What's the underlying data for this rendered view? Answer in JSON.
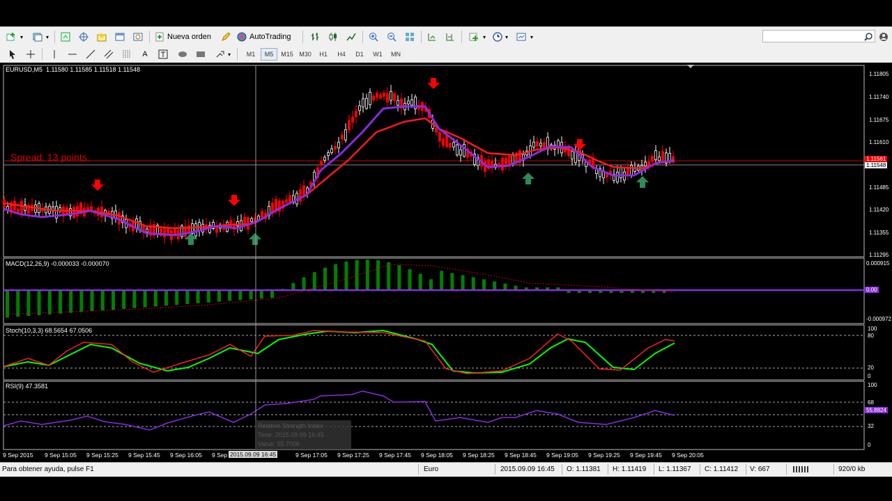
{
  "toolbar": {
    "new_order": "Nueva orden",
    "autotrading": "AutoTrading",
    "timeframes": [
      "M1",
      "M5",
      "M15",
      "M30",
      "H1",
      "H4",
      "D1",
      "W1",
      "MN"
    ],
    "selected_timeframe": "M5"
  },
  "chart": {
    "symbol_header": "EURUSD,M5  1.11580 1.11585 1.11518 1.11548",
    "spread_text": "Spread: 13 points.",
    "price_scale": [
      "1.11805",
      "1.11740",
      "1.11675",
      "1.11610",
      "1.11485",
      "1.11420",
      "1.11355",
      "1.11295"
    ],
    "bid_label": "1.11548",
    "ask_label": "1.11561",
    "macd": {
      "label": "MACD(12,26,9) -0.000033 -0.000070",
      "top": "0.000915",
      "zero": "0.00",
      "bottom": "-0.000972"
    },
    "stoch": {
      "label": "Stoch(10,3,3) 68.5654 67.0506",
      "levels": [
        "100",
        "80",
        "20",
        "0"
      ]
    },
    "rsi": {
      "label": "RSI(9) 47.3581",
      "levels": [
        "100",
        "68",
        "32",
        "0"
      ],
      "value_label": "55.8824"
    },
    "time_labels": [
      "9 Sep 2015",
      "9 Sep 15:05",
      "9 Sep 15:25",
      "9 Sep 15:45",
      "9 Sep 16:05",
      "9 Sep 16:25",
      "9 Sep 16:45",
      "9 Sep 17:05",
      "9 Sep 17:25",
      "9 Sep 17:45",
      "9 Sep 18:05",
      "9 Sep 18:25",
      "9 Sep 18:45",
      "9 Sep 19:05",
      "9 Sep 19:25",
      "9 Sep 19:45",
      "9 Sep 20:05"
    ],
    "crosshair_time": "2015.09.09 16:45",
    "tooltip": {
      "name": "Relative Strength Index",
      "time": "Time: 2015.09.09 16:45",
      "value": "Value: 55.7006"
    }
  },
  "status": {
    "help": "Para obtener ayuda, pulse F1",
    "profile": "Euro",
    "datetime": "2015.09.09 16:45",
    "open": "O: 1.11381",
    "high": "H: 1.11419",
    "low": "L: 1.11367",
    "close": "C: 1.11412",
    "volume": "V: 667",
    "traffic": "920/0 kb"
  },
  "colors": {
    "bull": "#ffffff",
    "bear": "#ff0000",
    "ma_fast": "#8a2be2",
    "ma_slow": "#ff0000",
    "macd_hist": "#008000",
    "stoch_main": "#00ff00",
    "stoch_signal": "#ff0000",
    "rsi": "#8a2be2",
    "buy_arrow": "#2e8b57",
    "sell_arrow": "#ff0000"
  }
}
